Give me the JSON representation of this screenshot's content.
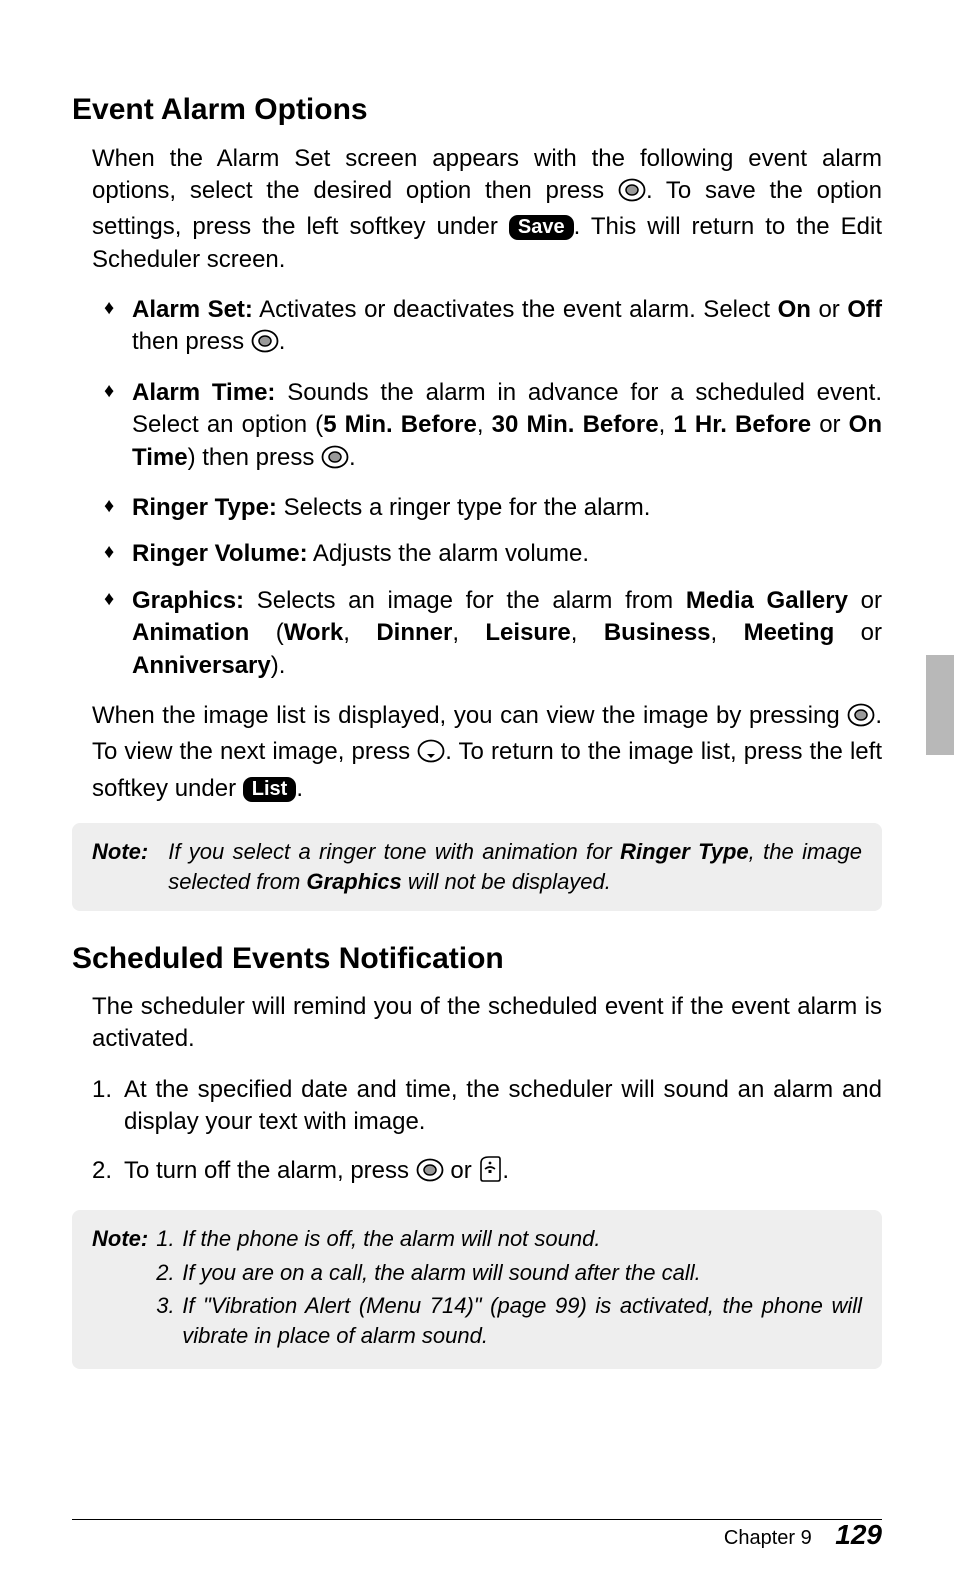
{
  "section1": {
    "heading": "Event Alarm Options",
    "intro_1": "When the Alarm Set screen appears with the following event alarm options, select the desired option then press ",
    "intro_2": ". To save the option settings, press the left softkey under ",
    "save_key": "Save",
    "intro_3": ". This will return to the Edit Scheduler screen.",
    "bullets": {
      "b1_label": "Alarm Set:",
      "b1_text1": " Activates or deactivates the event alarm. Select ",
      "b1_on": "On",
      "b1_or": " or ",
      "b1_off": "Off",
      "b1_then": " then press ",
      "b1_period": ".",
      "b2_label": "Alarm Time:",
      "b2_text1": " Sounds the alarm in advance for a scheduled event. Select an option (",
      "b2_opt1": "5 Min. Before",
      "b2_c1": ", ",
      "b2_opt2": "30 Min. Before",
      "b2_c2": ", ",
      "b2_opt3": "1 Hr. Before",
      "b2_or": " or ",
      "b2_opt4": "On Time",
      "b2_text2": ") then press ",
      "b2_period": ".",
      "b3_label": "Ringer Type:",
      "b3_text": " Selects a ringer type for the alarm.",
      "b4_label": "Ringer Volume:",
      "b4_text": " Adjusts the alarm volume.",
      "b5_label": "Graphics:",
      "b5_text1": " Selects an image for the alarm from ",
      "b5_mg": "Media Gallery",
      "b5_or1": " or ",
      "b5_anim": "Animation",
      "b5_open": " (",
      "b5_w": "Work",
      "b5_c1": ", ",
      "b5_d": "Dinner",
      "b5_c2": ", ",
      "b5_l": "Leisure",
      "b5_c3": ", ",
      "b5_bus": "Business",
      "b5_c4": ", ",
      "b5_meet": "Meeting",
      "b5_or2": " or ",
      "b5_anniv": "Anniversary",
      "b5_close": ")."
    },
    "para2_1": "When the image list is displayed, you can view the image by pressing ",
    "para2_2": ". To view the next image, press ",
    "para2_3": ". To return to the image list, press the left softkey under ",
    "list_key": "List",
    "para2_4": ".",
    "note_label": "Note:",
    "note_text1": "If you select a ringer tone with animation for ",
    "note_rt": "Ringer Type",
    "note_text2": ", the image selected from ",
    "note_gfx": "Graphics",
    "note_text3": " will not be displayed."
  },
  "section2": {
    "heading": "Scheduled Events Notification",
    "intro": "The scheduler will remind you of the scheduled event if the event alarm is activated.",
    "li1": "At the specified date and time, the scheduler will sound an alarm and display your text with image.",
    "li2_1": "To turn off the alarm, press ",
    "li2_or": " or ",
    "li2_2": ".",
    "note_label": "Note:",
    "n1": "If the phone is off, the alarm will not sound.",
    "n2": "If you are on a call, the alarm will sound after the call.",
    "n3": "If \"Vibration Alert (Menu 714)\" (page 99) is activated, the phone will vibrate in place of alarm sound."
  },
  "footer": {
    "chapter": "Chapter 9",
    "page": "129"
  }
}
